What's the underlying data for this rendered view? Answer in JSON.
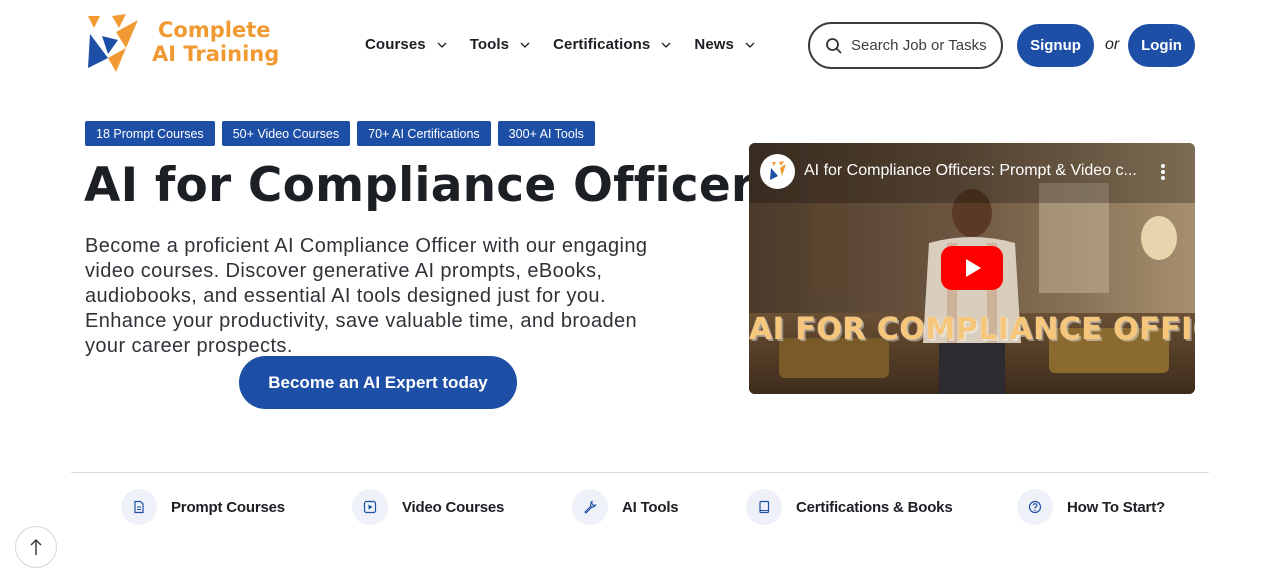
{
  "brand": {
    "line1": "Complete",
    "line2": "AI Training",
    "color": "#f19a33"
  },
  "nav": {
    "items": [
      {
        "label": "Courses"
      },
      {
        "label": "Tools"
      },
      {
        "label": "Certifications"
      },
      {
        "label": "News"
      }
    ]
  },
  "search": {
    "placeholder": "Search Job or Tasks",
    "icon": "search-icon"
  },
  "auth": {
    "signup": "Signup",
    "or": "or",
    "login": "Login"
  },
  "badges": [
    "18 Prompt Courses",
    "50+ Video Courses",
    "70+ AI Certifications",
    "300+ AI Tools"
  ],
  "hero": {
    "title": "AI for Compliance Officers",
    "description": "Become a proficient AI Compliance Officer with our engaging video courses. Discover generative AI prompts, eBooks, audiobooks, and essential AI tools designed just for you. Enhance your productivity, save valuable time, and broaden your career prospects.",
    "cta": "Become an AI Expert today"
  },
  "video": {
    "title": "AI for Compliance Officers: Prompt & Video c...",
    "caption": "AI FOR COMPLIANCE OFFICERS"
  },
  "quick_links": [
    {
      "label": "Prompt Courses",
      "icon": "document-icon"
    },
    {
      "label": "Video Courses",
      "icon": "play-icon"
    },
    {
      "label": "AI Tools",
      "icon": "wrench-icon"
    },
    {
      "label": "Certifications & Books",
      "icon": "book-icon"
    },
    {
      "label": "How To Start?",
      "icon": "question-icon"
    }
  ],
  "colors": {
    "primary": "#1e4fa6",
    "accent": "#f19a33",
    "text": "#1c1f23"
  }
}
